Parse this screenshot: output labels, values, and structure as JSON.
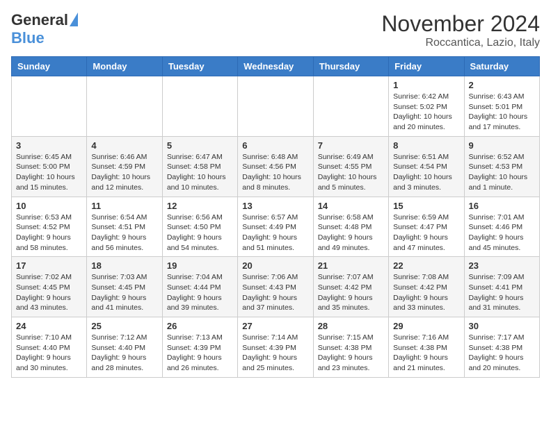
{
  "header": {
    "logo_general": "General",
    "logo_blue": "Blue",
    "month_title": "November 2024",
    "subtitle": "Roccantica, Lazio, Italy"
  },
  "days_of_week": [
    "Sunday",
    "Monday",
    "Tuesday",
    "Wednesday",
    "Thursday",
    "Friday",
    "Saturday"
  ],
  "weeks": [
    [
      {
        "day": "",
        "info": ""
      },
      {
        "day": "",
        "info": ""
      },
      {
        "day": "",
        "info": ""
      },
      {
        "day": "",
        "info": ""
      },
      {
        "day": "",
        "info": ""
      },
      {
        "day": "1",
        "info": "Sunrise: 6:42 AM\nSunset: 5:02 PM\nDaylight: 10 hours and 20 minutes."
      },
      {
        "day": "2",
        "info": "Sunrise: 6:43 AM\nSunset: 5:01 PM\nDaylight: 10 hours and 17 minutes."
      }
    ],
    [
      {
        "day": "3",
        "info": "Sunrise: 6:45 AM\nSunset: 5:00 PM\nDaylight: 10 hours and 15 minutes."
      },
      {
        "day": "4",
        "info": "Sunrise: 6:46 AM\nSunset: 4:59 PM\nDaylight: 10 hours and 12 minutes."
      },
      {
        "day": "5",
        "info": "Sunrise: 6:47 AM\nSunset: 4:58 PM\nDaylight: 10 hours and 10 minutes."
      },
      {
        "day": "6",
        "info": "Sunrise: 6:48 AM\nSunset: 4:56 PM\nDaylight: 10 hours and 8 minutes."
      },
      {
        "day": "7",
        "info": "Sunrise: 6:49 AM\nSunset: 4:55 PM\nDaylight: 10 hours and 5 minutes."
      },
      {
        "day": "8",
        "info": "Sunrise: 6:51 AM\nSunset: 4:54 PM\nDaylight: 10 hours and 3 minutes."
      },
      {
        "day": "9",
        "info": "Sunrise: 6:52 AM\nSunset: 4:53 PM\nDaylight: 10 hours and 1 minute."
      }
    ],
    [
      {
        "day": "10",
        "info": "Sunrise: 6:53 AM\nSunset: 4:52 PM\nDaylight: 9 hours and 58 minutes."
      },
      {
        "day": "11",
        "info": "Sunrise: 6:54 AM\nSunset: 4:51 PM\nDaylight: 9 hours and 56 minutes."
      },
      {
        "day": "12",
        "info": "Sunrise: 6:56 AM\nSunset: 4:50 PM\nDaylight: 9 hours and 54 minutes."
      },
      {
        "day": "13",
        "info": "Sunrise: 6:57 AM\nSunset: 4:49 PM\nDaylight: 9 hours and 51 minutes."
      },
      {
        "day": "14",
        "info": "Sunrise: 6:58 AM\nSunset: 4:48 PM\nDaylight: 9 hours and 49 minutes."
      },
      {
        "day": "15",
        "info": "Sunrise: 6:59 AM\nSunset: 4:47 PM\nDaylight: 9 hours and 47 minutes."
      },
      {
        "day": "16",
        "info": "Sunrise: 7:01 AM\nSunset: 4:46 PM\nDaylight: 9 hours and 45 minutes."
      }
    ],
    [
      {
        "day": "17",
        "info": "Sunrise: 7:02 AM\nSunset: 4:45 PM\nDaylight: 9 hours and 43 minutes."
      },
      {
        "day": "18",
        "info": "Sunrise: 7:03 AM\nSunset: 4:45 PM\nDaylight: 9 hours and 41 minutes."
      },
      {
        "day": "19",
        "info": "Sunrise: 7:04 AM\nSunset: 4:44 PM\nDaylight: 9 hours and 39 minutes."
      },
      {
        "day": "20",
        "info": "Sunrise: 7:06 AM\nSunset: 4:43 PM\nDaylight: 9 hours and 37 minutes."
      },
      {
        "day": "21",
        "info": "Sunrise: 7:07 AM\nSunset: 4:42 PM\nDaylight: 9 hours and 35 minutes."
      },
      {
        "day": "22",
        "info": "Sunrise: 7:08 AM\nSunset: 4:42 PM\nDaylight: 9 hours and 33 minutes."
      },
      {
        "day": "23",
        "info": "Sunrise: 7:09 AM\nSunset: 4:41 PM\nDaylight: 9 hours and 31 minutes."
      }
    ],
    [
      {
        "day": "24",
        "info": "Sunrise: 7:10 AM\nSunset: 4:40 PM\nDaylight: 9 hours and 30 minutes."
      },
      {
        "day": "25",
        "info": "Sunrise: 7:12 AM\nSunset: 4:40 PM\nDaylight: 9 hours and 28 minutes."
      },
      {
        "day": "26",
        "info": "Sunrise: 7:13 AM\nSunset: 4:39 PM\nDaylight: 9 hours and 26 minutes."
      },
      {
        "day": "27",
        "info": "Sunrise: 7:14 AM\nSunset: 4:39 PM\nDaylight: 9 hours and 25 minutes."
      },
      {
        "day": "28",
        "info": "Sunrise: 7:15 AM\nSunset: 4:38 PM\nDaylight: 9 hours and 23 minutes."
      },
      {
        "day": "29",
        "info": "Sunrise: 7:16 AM\nSunset: 4:38 PM\nDaylight: 9 hours and 21 minutes."
      },
      {
        "day": "30",
        "info": "Sunrise: 7:17 AM\nSunset: 4:38 PM\nDaylight: 9 hours and 20 minutes."
      }
    ]
  ]
}
